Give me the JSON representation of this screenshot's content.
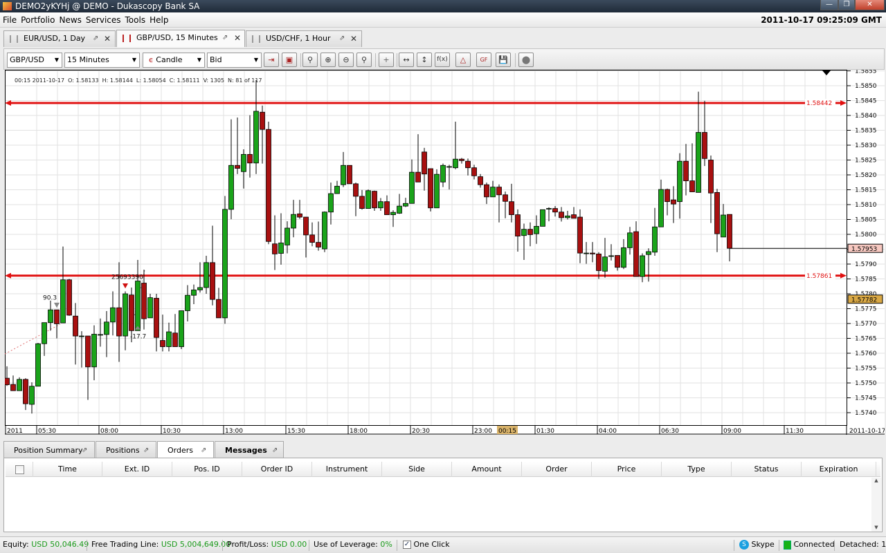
{
  "window": {
    "title": "DEMO2yKYHj @ DEMO - Dukascopy Bank SA",
    "clock": "2011-10-17 09:25:09 GMT"
  },
  "menu": [
    "File",
    "Portfolio",
    "News",
    "Services",
    "Tools",
    "Help"
  ],
  "chart_tabs": [
    {
      "label": "EUR/USD,  1 Day",
      "active": false
    },
    {
      "label": "GBP/USD,  15 Minutes",
      "active": true
    },
    {
      "label": "USD/CHF,  1 Hour",
      "active": false
    }
  ],
  "toolbar": {
    "instrument": "GBP/USD",
    "period": "15 Minutes",
    "chart_type": "Candle",
    "offer_side": "Bid",
    "buttons": [
      "chart-shift-icon",
      "lock-icon",
      "zoom-fit-icon",
      "zoom-in-icon",
      "zoom-out-icon",
      "zoom-area-icon",
      "cursor-icon",
      "horizontal-scale-icon",
      "vertical-scale-icon",
      "indicators-icon",
      "drawings-icon",
      "theme-icon",
      "save-icon",
      "stop-icon"
    ]
  },
  "info_bar": {
    "time": "00:15 2011-10-17",
    "open": "O: 1.58133",
    "high": "H: 1.58144",
    "low": "L: 1.58054",
    "close": "C: 1.58111",
    "volume": "V: 1305",
    "count": "N: 81 of 117"
  },
  "chart_data": {
    "type": "candlestick",
    "instrument": "GBP/USD",
    "period": "15 Minutes",
    "ylim": [
      1.5735,
      1.5855
    ],
    "y_ticks": [
      "1.5740",
      "1.5745",
      "1.5750",
      "1.5755",
      "1.5760",
      "1.5765",
      "1.5770",
      "1.5775",
      "1.5780",
      "1.5785",
      "1.5790",
      "1.5795",
      "1.5800",
      "1.5805",
      "1.5810",
      "1.5815",
      "1.5820",
      "1.5825",
      "1.5830",
      "1.5835",
      "1.5840",
      "1.5845",
      "1.5850",
      "1.5855"
    ],
    "x_labels": [
      {
        "label": "2011",
        "index": 1
      },
      {
        "label": "05:30",
        "index": 6
      },
      {
        "label": "08:00",
        "index": 16
      },
      {
        "label": "10:30",
        "index": 26
      },
      {
        "label": "13:00",
        "index": 36
      },
      {
        "label": "15:30",
        "index": 46
      },
      {
        "label": "18:00",
        "index": 56
      },
      {
        "label": "20:30",
        "index": 66
      },
      {
        "label": "23:00",
        "index": 76
      },
      {
        "label": "01:30",
        "index": 86
      },
      {
        "label": "04:00",
        "index": 96
      },
      {
        "label": "06:30",
        "index": 106
      },
      {
        "label": "09:00",
        "index": 116
      },
      {
        "label": "11:30",
        "index": 126
      }
    ],
    "cursor_time": {
      "label": "00:15",
      "index": 81
    },
    "axis_date": "2011-10-17",
    "horizontal_lines": [
      {
        "price": 1.58442,
        "label": "1.58442",
        "color": "#e01010"
      },
      {
        "price": 1.57861,
        "label": "1.57861",
        "color": "#e01010"
      }
    ],
    "current_price": {
      "price": 1.57953,
      "label": "1.57953",
      "color": "#f7c8c0"
    },
    "cursor_price": {
      "price": 1.57782,
      "label": "1.57782",
      "color": "#d9a845"
    },
    "annotations": [
      {
        "text": "90.3",
        "index": 9,
        "price": 1.5778
      },
      {
        "text": "25693390",
        "index": 20,
        "price": 1.5785
      },
      {
        "text": "-17.7",
        "index": 23,
        "price": 1.5765
      }
    ],
    "colors": {
      "up": "#1aa31a",
      "down": "#a81010"
    },
    "ohlc": [
      [
        1.57516,
        1.57556,
        1.5749,
        1.57494
      ],
      [
        1.57495,
        1.57525,
        1.57474,
        1.57474
      ],
      [
        1.57474,
        1.57519,
        1.57474,
        1.57512
      ],
      [
        1.57512,
        1.57516,
        1.57409,
        1.5743
      ],
      [
        1.57428,
        1.57502,
        1.57397,
        1.57489
      ],
      [
        1.57489,
        1.57635,
        1.57489,
        1.57632
      ],
      [
        1.57632,
        1.5768,
        1.57591,
        1.57703
      ],
      [
        1.57703,
        1.57777,
        1.57676,
        1.57746
      ],
      [
        1.57746,
        1.57746,
        1.5765,
        1.57699
      ],
      [
        1.57702,
        1.57959,
        1.57702,
        1.57847
      ],
      [
        1.57847,
        1.5785,
        1.57726,
        1.57728
      ],
      [
        1.57725,
        1.57769,
        1.57562,
        1.57658
      ],
      [
        1.57658,
        1.57674,
        1.57552,
        1.57658
      ],
      [
        1.57658,
        1.57658,
        1.57443,
        1.57554
      ],
      [
        1.57554,
        1.57694,
        1.57509,
        1.57664
      ],
      [
        1.57663,
        1.57717,
        1.57622,
        1.57663
      ],
      [
        1.57663,
        1.57742,
        1.57587,
        1.57705
      ],
      [
        1.57705,
        1.57808,
        1.5766,
        1.57753
      ],
      [
        1.57753,
        1.57906,
        1.57571,
        1.57658
      ],
      [
        1.57658,
        1.57808,
        1.5761,
        1.578
      ],
      [
        1.57796,
        1.57821,
        1.57637,
        1.57676
      ],
      [
        1.57676,
        1.57914,
        1.57676,
        1.57843
      ],
      [
        1.57836,
        1.57881,
        1.5768,
        1.57716
      ],
      [
        1.57719,
        1.578,
        1.57719,
        1.57787
      ],
      [
        1.57785,
        1.578,
        1.57606,
        1.57653
      ],
      [
        1.57643,
        1.5773,
        1.57606,
        1.57622
      ],
      [
        1.57622,
        1.57703,
        1.57606,
        1.57672
      ],
      [
        1.57668,
        1.57732,
        1.57622,
        1.57622
      ],
      [
        1.57622,
        1.57743,
        1.57614,
        1.57743
      ],
      [
        1.57743,
        1.57829,
        1.57707,
        1.57795
      ],
      [
        1.57795,
        1.57831,
        1.57765,
        1.57813
      ],
      [
        1.57813,
        1.57906,
        1.57804,
        1.57821
      ],
      [
        1.57821,
        1.57928,
        1.578,
        1.57905
      ],
      [
        1.57905,
        1.58029,
        1.57761,
        1.57781
      ],
      [
        1.57781,
        1.5782,
        1.57719,
        1.57719
      ],
      [
        1.57719,
        1.58129,
        1.57699,
        1.58084
      ],
      [
        1.58084,
        1.58387,
        1.58051,
        1.58232
      ],
      [
        1.58232,
        1.58393,
        1.58203,
        1.58222
      ],
      [
        1.58211,
        1.58286,
        1.58154,
        1.58269
      ],
      [
        1.58269,
        1.58401,
        1.58191,
        1.5824
      ],
      [
        1.5824,
        1.58519,
        1.58203,
        1.58414
      ],
      [
        1.58411,
        1.58433,
        1.58238,
        1.58353
      ],
      [
        1.58353,
        1.58379,
        1.57967,
        1.57976
      ],
      [
        1.57968,
        1.58064,
        1.5788,
        1.57934
      ],
      [
        1.57936,
        1.58071,
        1.57898,
        1.57971
      ],
      [
        1.57964,
        1.58044,
        1.57936,
        1.58021
      ],
      [
        1.58021,
        1.58116,
        1.5799,
        1.58067
      ],
      [
        1.58069,
        1.58116,
        1.58052,
        1.58058
      ],
      [
        1.58058,
        1.58058,
        1.57922,
        1.57998
      ],
      [
        1.57998,
        1.5804,
        1.5796,
        1.57973
      ],
      [
        1.57973,
        1.58043,
        1.57945,
        1.57957
      ],
      [
        1.57951,
        1.58077,
        1.5794,
        1.58075
      ],
      [
        1.58075,
        1.58174,
        1.58033,
        1.58137
      ],
      [
        1.58137,
        1.5818,
        1.58136,
        1.58162
      ],
      [
        1.58167,
        1.58277,
        1.58159,
        1.58232
      ],
      [
        1.58232,
        1.58232,
        1.5817,
        1.5817
      ],
      [
        1.5817,
        1.58174,
        1.58061,
        1.58128
      ],
      [
        1.58128,
        1.58149,
        1.58083,
        1.58087
      ],
      [
        1.58087,
        1.58151,
        1.58087,
        1.58147
      ],
      [
        1.58145,
        1.58147,
        1.58079,
        1.58089
      ],
      [
        1.58089,
        1.58122,
        1.58079,
        1.5811
      ],
      [
        1.5811,
        1.58131,
        1.58066,
        1.58066
      ],
      [
        1.58066,
        1.58081,
        1.58025,
        1.58074
      ],
      [
        1.58071,
        1.58136,
        1.58069,
        1.58095
      ],
      [
        1.58095,
        1.58123,
        1.58092,
        1.58104
      ],
      [
        1.58104,
        1.58252,
        1.58104,
        1.58209
      ],
      [
        1.58209,
        1.58337,
        1.58176,
        1.58176
      ],
      [
        1.58277,
        1.58291,
        1.58147,
        1.58203
      ],
      [
        1.58221,
        1.58221,
        1.58077,
        1.58089
      ],
      [
        1.58089,
        1.58219,
        1.58089,
        1.58202
      ],
      [
        1.58176,
        1.58238,
        1.58159,
        1.58232
      ],
      [
        1.58228,
        1.58234,
        1.58151,
        1.58228
      ],
      [
        1.58224,
        1.58379,
        1.58219,
        1.58253
      ],
      [
        1.58253,
        1.58257,
        1.58238,
        1.58248
      ],
      [
        1.58246,
        1.58255,
        1.58198,
        1.58224
      ],
      [
        1.58224,
        1.58234,
        1.58185,
        1.58197
      ],
      [
        1.58194,
        1.58203,
        1.58157,
        1.58167
      ],
      [
        1.58167,
        1.58174,
        1.58102,
        1.58126
      ],
      [
        1.58126,
        1.5818,
        1.58126,
        1.58159
      ],
      [
        1.58159,
        1.58168,
        1.5804,
        1.58133
      ],
      [
        1.58133,
        1.58144,
        1.58054,
        1.58111
      ],
      [
        1.5811,
        1.5817,
        1.5804,
        1.58066
      ],
      [
        1.58066,
        1.58084,
        1.57942,
        1.57994
      ],
      [
        1.57996,
        1.58036,
        1.57914,
        1.58017
      ],
      [
        1.58017,
        1.5804,
        1.5796,
        1.57999
      ],
      [
        1.58002,
        1.58064,
        1.57968,
        1.58027
      ],
      [
        1.58027,
        1.58083,
        1.58027,
        1.58083
      ],
      [
        1.58087,
        1.58091,
        1.58044,
        1.58087
      ],
      [
        1.58087,
        1.58095,
        1.5806,
        1.58075
      ],
      [
        1.58075,
        1.58092,
        1.58043,
        1.58056
      ],
      [
        1.58056,
        1.58079,
        1.5805,
        1.58062
      ],
      [
        1.58066,
        1.58092,
        1.58054,
        1.58054
      ],
      [
        1.58058,
        1.58084,
        1.57903,
        1.57937
      ],
      [
        1.57937,
        1.57974,
        1.57901,
        1.57937
      ],
      [
        1.57937,
        1.57974,
        1.57906,
        1.57934
      ],
      [
        1.57934,
        1.5794,
        1.5785,
        1.57878
      ],
      [
        1.57876,
        1.57988,
        1.57854,
        1.57924
      ],
      [
        1.57928,
        1.57967,
        1.57912,
        1.57928
      ],
      [
        1.57929,
        1.57929,
        1.57878,
        1.57889
      ],
      [
        1.57889,
        1.57984,
        1.57883,
        1.57955
      ],
      [
        1.57955,
        1.58025,
        1.57932,
        1.58005
      ],
      [
        1.58009,
        1.58044,
        1.57858,
        1.57858
      ],
      [
        1.57858,
        1.57936,
        1.57839,
        1.57928
      ],
      [
        1.57932,
        1.57953,
        1.57841,
        1.57942
      ],
      [
        1.5794,
        1.58089,
        1.57928,
        1.58025
      ],
      [
        1.58025,
        1.58184,
        1.58025,
        1.58151
      ],
      [
        1.58151,
        1.58154,
        1.58064,
        1.5811
      ],
      [
        1.58116,
        1.58162,
        1.58038,
        1.58102
      ],
      [
        1.5811,
        1.58273,
        1.58053,
        1.58246
      ],
      [
        1.58246,
        1.58304,
        1.58131,
        1.5818
      ],
      [
        1.5818,
        1.58306,
        1.58143,
        1.58143
      ],
      [
        1.58141,
        1.5848,
        1.58141,
        1.58343
      ],
      [
        1.58343,
        1.58449,
        1.5823,
        1.58255
      ],
      [
        1.5825,
        1.58265,
        1.58038,
        1.58139
      ],
      [
        1.58141,
        1.58153,
        1.5794,
        1.58002
      ],
      [
        1.57991,
        1.58102,
        1.57991,
        1.58065
      ],
      [
        1.58067,
        1.58067,
        1.57909,
        1.57953
      ]
    ]
  },
  "bottom_tabs": [
    {
      "label": "Position Summary",
      "active": false,
      "bold": false
    },
    {
      "label": "Positions",
      "active": false,
      "bold": false
    },
    {
      "label": "Orders",
      "active": true,
      "bold": false
    },
    {
      "label": "Messages",
      "active": false,
      "bold": true
    }
  ],
  "orders_table": {
    "columns": [
      "Time",
      "Ext. ID",
      "Pos. ID",
      "Order ID",
      "Instrument",
      "Side",
      "Amount",
      "Order",
      "Price",
      "Type",
      "Status",
      "Expiration"
    ],
    "rows": []
  },
  "status_bar": {
    "equity_label": "Equity:",
    "equity_value": "USD 50,046.49",
    "ftl_label": "Free Trading Line:",
    "ftl_value": "USD 5,004,649.00",
    "pl_label": "Profit/Loss:",
    "pl_value": "USD 0.00",
    "leverage_label": "Use of Leverage:",
    "leverage_value": "0%",
    "one_click_label": "One Click",
    "one_click_checked": true,
    "skype_label": "Skype",
    "connection_label": "Connected",
    "detached_label": "Detached: 1"
  }
}
